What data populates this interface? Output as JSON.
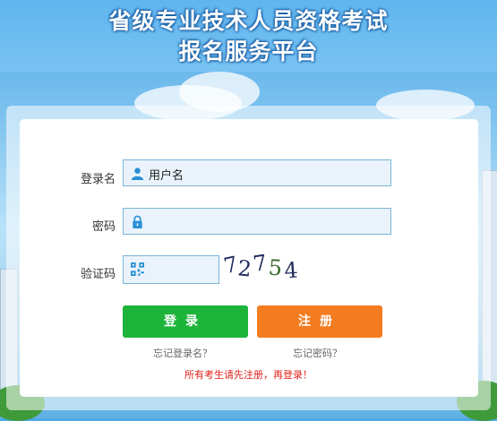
{
  "header": {
    "title_line1": "省级专业技术人员资格考试",
    "title_line2": "报名服务平台"
  },
  "form": {
    "username_label": "登录名",
    "username_placeholder": "用户名",
    "password_label": "密码",
    "captcha_label": "验证码",
    "captcha_digits": [
      "7",
      "2",
      "7",
      "5",
      "4"
    ]
  },
  "buttons": {
    "login": "登录",
    "register": "注册"
  },
  "links": {
    "forgot_username": "忘记登录名？",
    "forgot_password": "忘记密码？"
  },
  "notice": "所有考生请先注册，再登录！",
  "colors": {
    "login_button": "#1eb43c",
    "register_button": "#f47c20",
    "notice_text": "#e0201c",
    "icon_blue": "#2a8fd6"
  }
}
